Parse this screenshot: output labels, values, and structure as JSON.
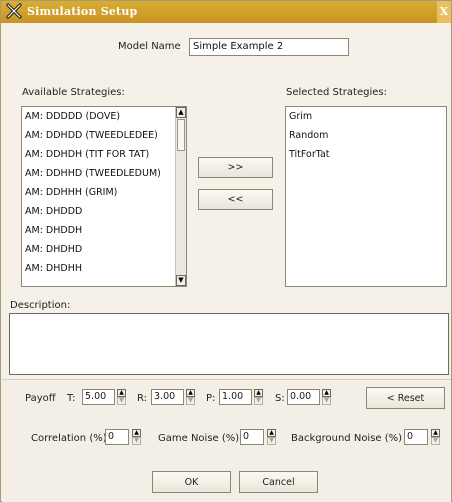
{
  "window": {
    "title": "Simulation Setup",
    "close_glyph": "X"
  },
  "model": {
    "label": "Model Name",
    "value": "Simple Example 2"
  },
  "available": {
    "label": "Available Strategies:",
    "items": [
      "AM: DDDDD (DOVE)",
      "AM: DDHDD (TWEEDLEDEE)",
      "AM: DDHDH (TIT FOR TAT)",
      "AM: DDHHD (TWEEDLEDUM)",
      "AM: DDHHH (GRIM)",
      "AM: DHDDD",
      "AM: DHDDH",
      "AM: DHDHD",
      "AM: DHDHH"
    ]
  },
  "selected": {
    "label": "Selected Strategies:",
    "items": [
      "Grim",
      "Random",
      "TitForTat"
    ]
  },
  "transfer": {
    "add_label": ">>",
    "remove_label": "<<"
  },
  "description": {
    "label": "Description:",
    "value": ""
  },
  "payoff": {
    "label": "Payoff",
    "t": {
      "label": "T:",
      "value": "5.00"
    },
    "r": {
      "label": "R:",
      "value": "3.00"
    },
    "p": {
      "label": "P:",
      "value": "1.00"
    },
    "s": {
      "label": "S:",
      "value": "0.00"
    },
    "reset_label": "< Reset"
  },
  "noise": {
    "correlation": {
      "label": "Correlation (%)",
      "value": "0"
    },
    "game": {
      "label": "Game Noise (%)",
      "value": "0"
    },
    "background": {
      "label": "Background Noise (%)",
      "value": "0"
    }
  },
  "actions": {
    "ok_label": "OK",
    "cancel_label": "Cancel"
  },
  "icons": {
    "app": "x-logo-icon",
    "spinner_up": "triangle-up-icon",
    "spinner_down": "triangle-down-icon",
    "scroll_up": "triangle-up-icon",
    "scroll_down": "triangle-down-icon"
  },
  "colors": {
    "titlebar": "#c99422",
    "window_bg": "#f5f1e9"
  }
}
